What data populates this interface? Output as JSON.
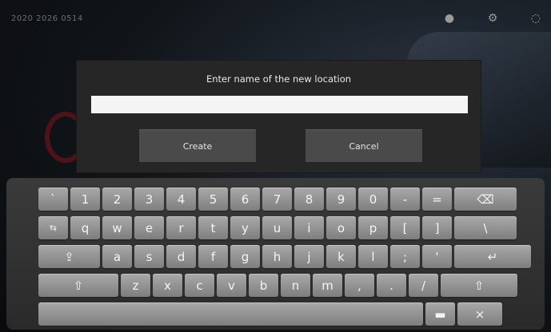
{
  "status": {
    "time": "2020 2026 0514"
  },
  "dialog": {
    "title": "Enter name of the new location",
    "input_value": "",
    "create_label": "Create",
    "cancel_label": "Cancel"
  },
  "keyboard": {
    "row1": [
      "`",
      "1",
      "2",
      "3",
      "4",
      "5",
      "6",
      "7",
      "8",
      "9",
      "0",
      "-",
      "=",
      "⌫"
    ],
    "row2": [
      "⇆",
      "q",
      "w",
      "e",
      "r",
      "t",
      "y",
      "u",
      "i",
      "o",
      "p",
      "[",
      "]",
      "\\"
    ],
    "row3": [
      "⇪",
      "a",
      "s",
      "d",
      "f",
      "g",
      "h",
      "j",
      "k",
      "l",
      ";",
      "'",
      "↵"
    ],
    "row4": [
      "⇧",
      "z",
      "x",
      "c",
      "v",
      "b",
      "n",
      "m",
      ",",
      ".",
      "/",
      "⇧"
    ],
    "row5": [
      "",
      "▬",
      "×"
    ]
  },
  "colors": {
    "accent_red": "#5a1417"
  }
}
